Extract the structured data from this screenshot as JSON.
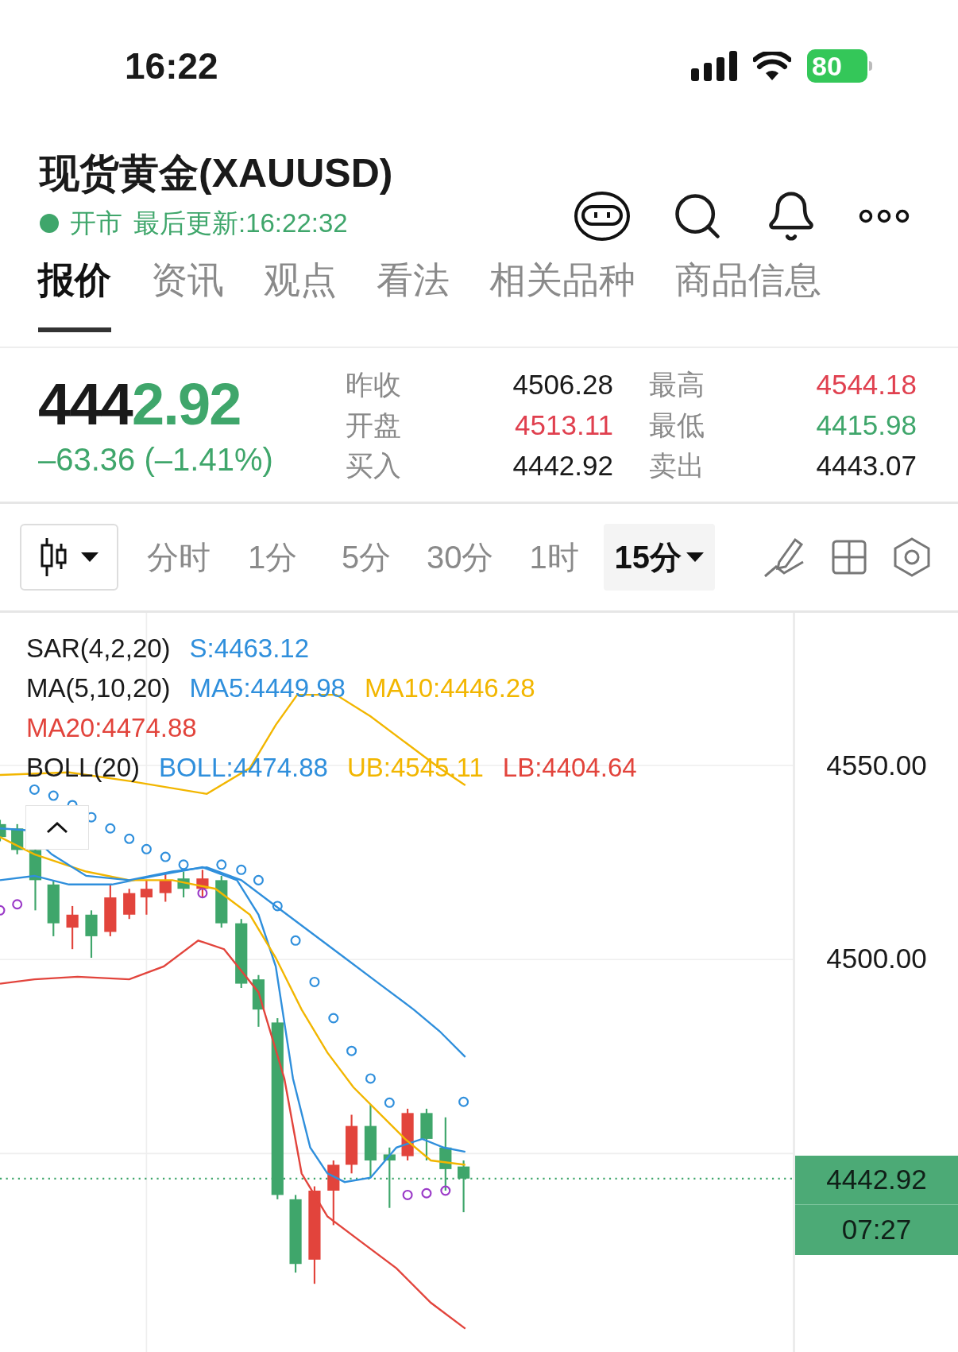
{
  "status_bar": {
    "time": "16:22",
    "battery": "80"
  },
  "header": {
    "title": "现货黄金(XAUUSD)",
    "market_open": true,
    "market_status": "开市",
    "last_update": "最后更新:16:22:32"
  },
  "tabs": [
    {
      "label": "报价",
      "selected": true
    },
    {
      "label": "资讯",
      "selected": false
    },
    {
      "label": "观点",
      "selected": false
    },
    {
      "label": "看法",
      "selected": false
    },
    {
      "label": "相关品种",
      "selected": false
    },
    {
      "label": "商品信息",
      "selected": false
    }
  ],
  "quote": {
    "price_unchanged": "444",
    "price_changed": "2.92",
    "change": "–63.36 (–1.41%)",
    "stats": [
      {
        "label": "昨收",
        "value": "4506.28",
        "color": "#1a1a1a"
      },
      {
        "label": "最高",
        "value": "4544.18",
        "color": "#e0404f"
      },
      {
        "label": "开盘",
        "value": "4513.11",
        "color": "#e0404f"
      },
      {
        "label": "最低",
        "value": "4415.98",
        "color": "#3fa66b"
      },
      {
        "label": "买入",
        "value": "4442.92",
        "color": "#1a1a1a"
      },
      {
        "label": "卖出",
        "value": "4443.07",
        "color": "#1a1a1a"
      }
    ]
  },
  "toolbar": {
    "intervals": [
      {
        "label": "分时",
        "selected": false
      },
      {
        "label": "1分",
        "selected": false
      },
      {
        "label": "5分",
        "selected": false
      },
      {
        "label": "30分",
        "selected": false
      },
      {
        "label": "1时",
        "selected": false
      },
      {
        "label": "15分",
        "selected": true
      }
    ]
  },
  "chart": {
    "legend": [
      {
        "items": [
          {
            "text": "SAR(4,2,20)",
            "color": "#1a1a1a"
          },
          {
            "text": "S:4463.12",
            "color": "#2f8fdc"
          }
        ]
      },
      {
        "items": [
          {
            "text": "MA(5,10,20)",
            "color": "#1a1a1a"
          },
          {
            "text": "MA5:4449.98",
            "color": "#2f8fdc"
          },
          {
            "text": "MA10:4446.28",
            "color": "#f2b600"
          }
        ]
      },
      {
        "items": [
          {
            "text": "MA20:4474.88",
            "color": "#e2443c"
          }
        ]
      },
      {
        "items": [
          {
            "text": "BOLL(20)",
            "color": "#1a1a1a"
          },
          {
            "text": "BOLL:4474.88",
            "color": "#2f8fdc"
          },
          {
            "text": "UB:4545.11",
            "color": "#f2b600"
          },
          {
            "text": "LB:4404.64",
            "color": "#e2443c"
          }
        ]
      }
    ],
    "y_axis": [
      "4550.00",
      "4500.00"
    ],
    "price_tag": {
      "price": "4442.92",
      "countdown": "07:27"
    }
  }
}
